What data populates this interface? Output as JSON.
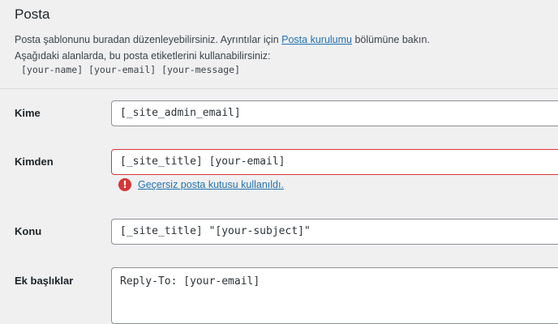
{
  "section": {
    "title": "Posta",
    "description_part1": "Posta şablonunu buradan düzenleyebilirsiniz. Ayrıntılar için ",
    "description_link": "Posta kurulumu",
    "description_part2": " bölümüne bakın.",
    "description_line2": "Aşağıdaki alanlarda, bu posta etiketlerini kullanabilirsiniz:",
    "tags": "[your-name] [your-email] [your-message]"
  },
  "fields": {
    "to": {
      "label": "Kime",
      "value": "[_site_admin_email]"
    },
    "from": {
      "label": "Kimden",
      "value": "[_site_title] [your-email]",
      "error": "Geçersiz posta kutusu kullanıldı."
    },
    "subject": {
      "label": "Konu",
      "value": "[_site_title] \"[your-subject]\""
    },
    "headers": {
      "label": "Ek başlıklar",
      "value": "Reply-To: [your-email]"
    }
  },
  "colors": {
    "error": "#d63638",
    "link": "#2271b1"
  }
}
